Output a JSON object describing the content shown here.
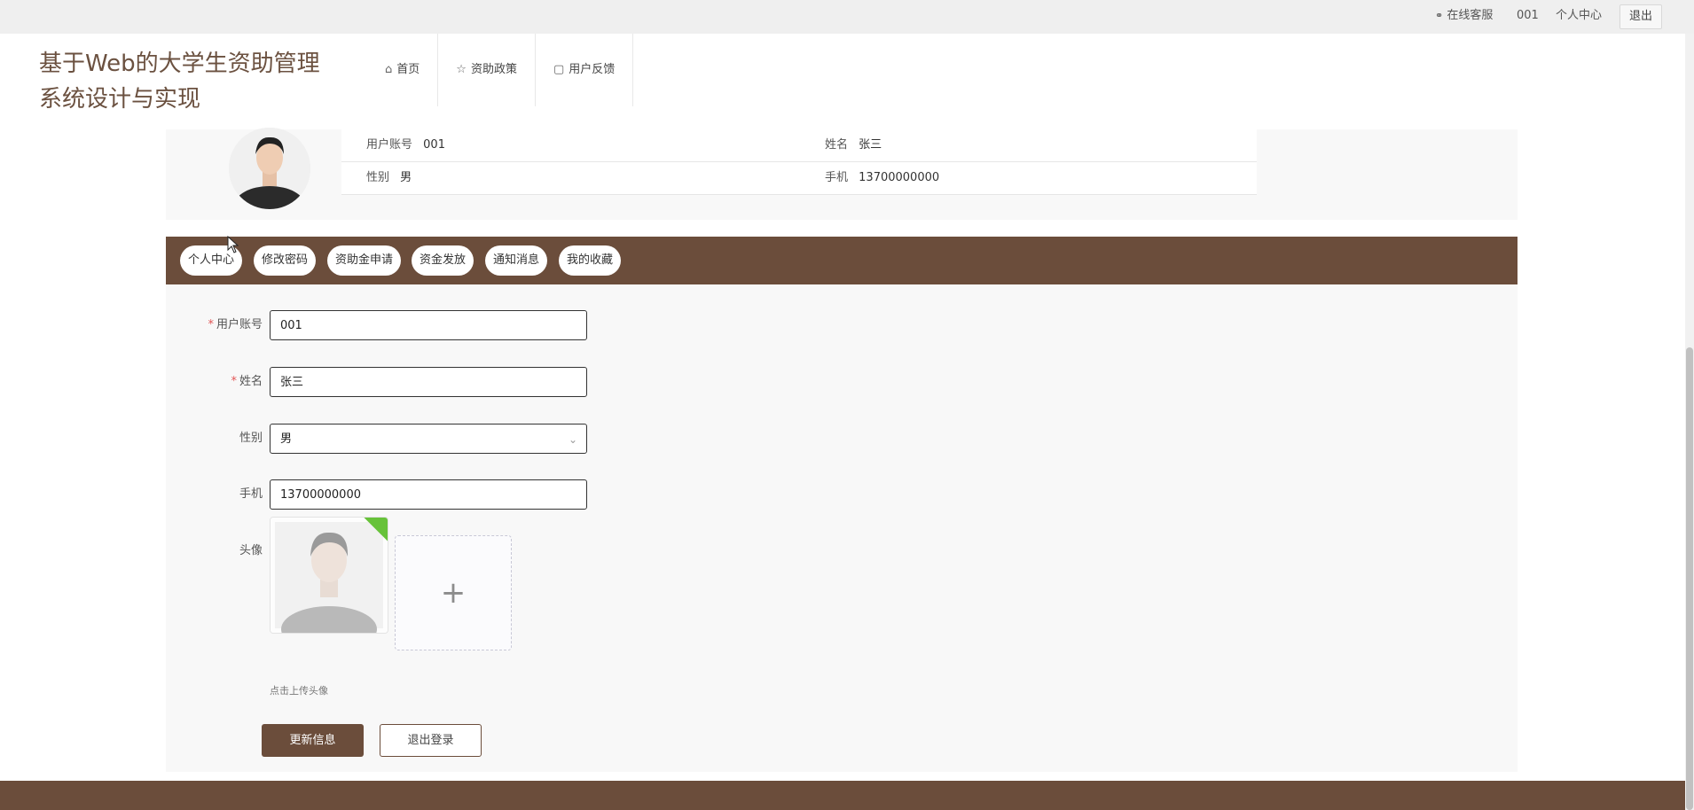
{
  "topbar": {
    "service": "在线客服",
    "user": "001",
    "center": "个人中心",
    "logout": "退出"
  },
  "header": {
    "title": "基于Web的大学生资助管理系统设计与实现",
    "nav": [
      {
        "label": "首页",
        "icon": "home-icon"
      },
      {
        "label": "资助政策",
        "icon": "star-icon"
      },
      {
        "label": "用户反馈",
        "icon": "bag-icon"
      }
    ]
  },
  "profile": {
    "rows": [
      [
        {
          "label": "用户账号",
          "value": "001"
        },
        {
          "label": "姓名",
          "value": "张三"
        }
      ],
      [
        {
          "label": "性别",
          "value": "男"
        },
        {
          "label": "手机",
          "value": "13700000000"
        }
      ]
    ]
  },
  "tabs": [
    "个人中心",
    "修改密码",
    "资助金申请",
    "资金发放",
    "通知消息",
    "我的收藏"
  ],
  "form": {
    "account_label": "用户账号",
    "account_value": "001",
    "name_label": "姓名",
    "name_value": "张三",
    "gender_label": "性别",
    "gender_value": "男",
    "phone_label": "手机",
    "phone_value": "13700000000",
    "avatar_label": "头像",
    "upload_tip": "点击上传头像",
    "update_button": "更新信息",
    "logout_button": "退出登录"
  },
  "colors": {
    "brand": "#6b4d3b",
    "title": "#6b5140",
    "required": "#e25555",
    "success": "#67c23a"
  }
}
